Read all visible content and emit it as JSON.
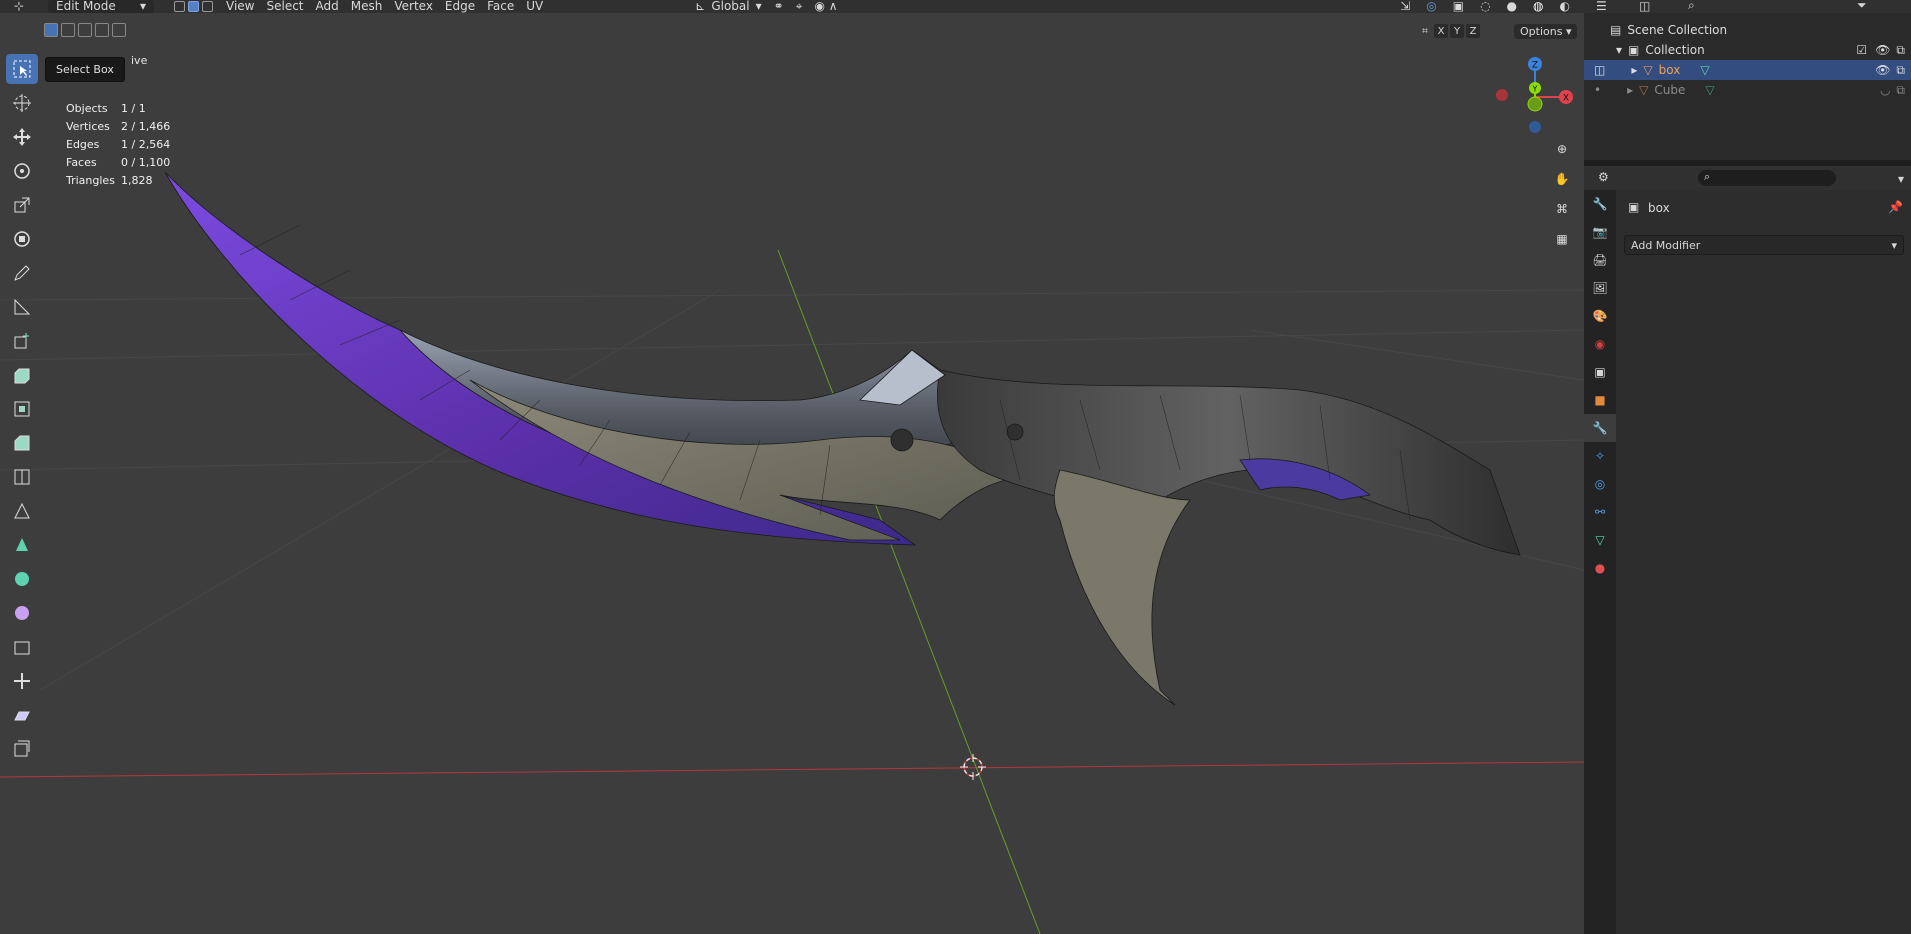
{
  "header": {
    "mode": "Edit Mode",
    "menus": [
      "View",
      "Select",
      "Add",
      "Mesh",
      "Vertex",
      "Edge",
      "Face",
      "UV"
    ],
    "orientation": "Global",
    "options_label": "Options",
    "axes": [
      "X",
      "Y",
      "Z"
    ]
  },
  "tooltip": {
    "text": "Select Box",
    "trailing": "ive"
  },
  "stats": [
    {
      "label": "Objects",
      "value": "1 / 1"
    },
    {
      "label": "Vertices",
      "value": "2 / 1,466"
    },
    {
      "label": "Edges",
      "value": "1 / 2,564"
    },
    {
      "label": "Faces",
      "value": "0 / 1,100"
    },
    {
      "label": "Triangles",
      "value": "1,828"
    }
  ],
  "gizmo": {
    "x": "X",
    "y": "Y",
    "z": "Z"
  },
  "outliner": {
    "root": "Scene Collection",
    "collection": "Collection",
    "items": [
      {
        "name": "box",
        "selected": true
      },
      {
        "name": "Cube",
        "selected": false
      }
    ]
  },
  "properties": {
    "object_name": "box",
    "add_modifier_label": "Add Modifier"
  },
  "colors": {
    "accent": "#4772b3",
    "x_axis": "#e0424b",
    "y_axis": "#8bdc00",
    "z_axis": "#3c83e0",
    "blade_purple": "#6a35c8"
  }
}
